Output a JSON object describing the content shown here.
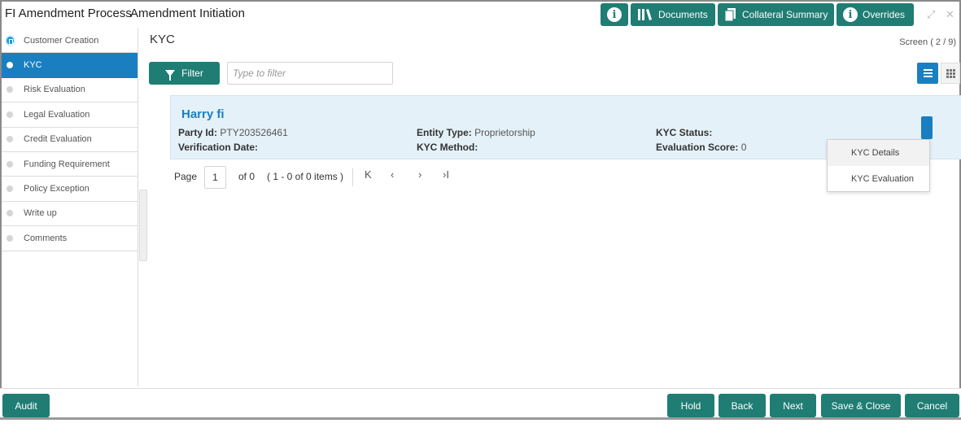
{
  "header": {
    "title": "FI Amendment Process",
    "subtitle": "Amendment Initiation",
    "buttons": {
      "info_label": "i",
      "documents": "Documents",
      "collateral_summary": "Collateral Summary",
      "overrides": "Overrides"
    },
    "icons": [
      "info-icon",
      "library-icon",
      "document-icon",
      "info-icon",
      "expand-icon",
      "close-icon"
    ]
  },
  "sidebar": {
    "items": [
      {
        "label": "Customer Creation"
      },
      {
        "label": "KYC"
      },
      {
        "label": "Risk Evaluation"
      },
      {
        "label": "Legal Evaluation"
      },
      {
        "label": "Credit Evaluation"
      },
      {
        "label": "Funding Requirement"
      },
      {
        "label": "Policy Exception"
      },
      {
        "label": "Write up"
      },
      {
        "label": "Comments"
      }
    ],
    "active_index": 1
  },
  "main": {
    "title": "KYC",
    "screen_counter": "Screen ( 2 / 9)",
    "filter_label": "Filter",
    "filter_placeholder": "Type to filter"
  },
  "card": {
    "name": "Harry fi",
    "party_id_label": "Party Id:",
    "party_id_value": "PTY203526461",
    "verification_date_label": "Verification Date:",
    "entity_type_label": "Entity Type:",
    "entity_type_value": "Proprietorship",
    "kyc_method_label": "KYC Method:",
    "kyc_status_label": "KYC Status:",
    "evaluation_score_label": "Evaluation Score:",
    "evaluation_score_value": "0"
  },
  "dropdown": {
    "items": [
      "KYC Details",
      "KYC Evaluation"
    ]
  },
  "pagination": {
    "page_label": "Page",
    "page_value": "1",
    "of_label": "of 0",
    "range_label": "( 1 - 0 of 0 items )",
    "first": "K",
    "prev": "‹",
    "next": "›",
    "last": "›I"
  },
  "footer": {
    "audit": "Audit",
    "hold": "Hold",
    "back": "Back",
    "next": "Next",
    "save_close": "Save & Close",
    "cancel": "Cancel"
  },
  "colors": {
    "teal": "#1f7d74",
    "blue": "#1a7fc1",
    "card_bg": "#e5f1f8"
  }
}
